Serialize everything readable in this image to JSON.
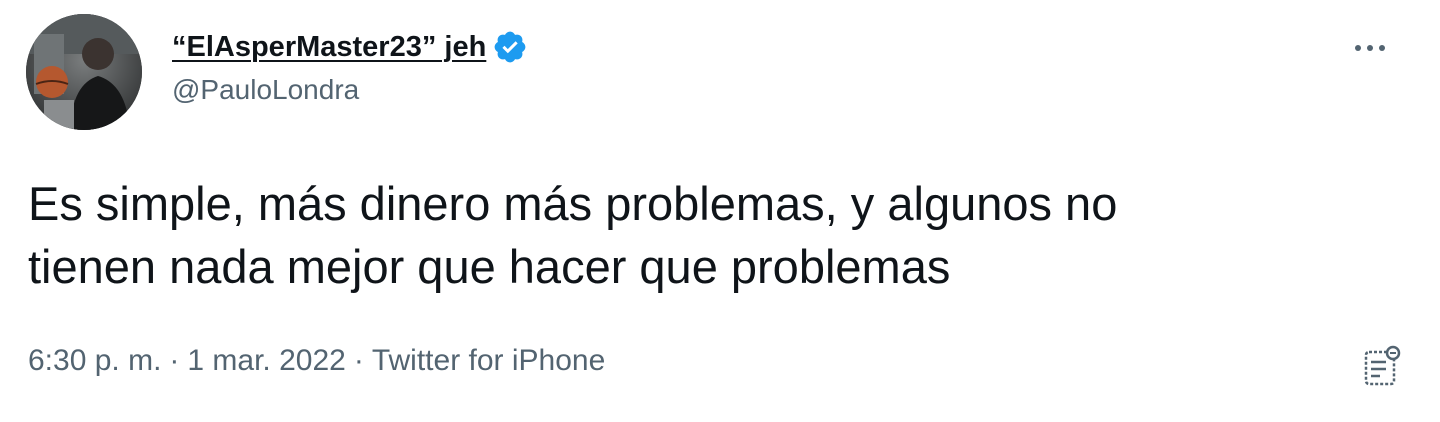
{
  "tweet": {
    "author": {
      "display_name": "“ElAsperMaster23” jeh",
      "handle": "@PauloLondra",
      "verified": true
    },
    "text_line1": "Es simple, más dinero más problemas, y algunos no",
    "text_line2": "tienen nada mejor que hacer que problemas",
    "time": "6:30 p. m.",
    "separator": "·",
    "date": "1 mar. 2022",
    "source": "Twitter for iPhone",
    "icons": {
      "verified": "verified-badge-icon",
      "more": "more-options-icon",
      "analytics": "analytics-icon"
    },
    "colors": {
      "verified_blue": "#1d9bf0",
      "secondary_text": "#536471",
      "primary_text": "#0f1419"
    }
  }
}
